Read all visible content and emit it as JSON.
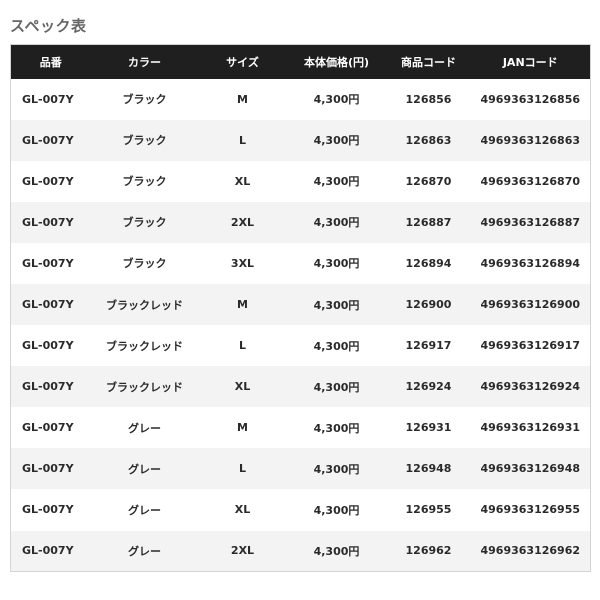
{
  "section_title": "スペック表",
  "table": {
    "headers": [
      "品番",
      "カラー",
      "サイズ",
      "本体価格(円)",
      "商品コード",
      "JANコード"
    ],
    "rows": [
      [
        "GL-007Y",
        "ブラック",
        "M",
        "4,300円",
        "126856",
        "4969363126856"
      ],
      [
        "GL-007Y",
        "ブラック",
        "L",
        "4,300円",
        "126863",
        "4969363126863"
      ],
      [
        "GL-007Y",
        "ブラック",
        "XL",
        "4,300円",
        "126870",
        "4969363126870"
      ],
      [
        "GL-007Y",
        "ブラック",
        "2XL",
        "4,300円",
        "126887",
        "4969363126887"
      ],
      [
        "GL-007Y",
        "ブラック",
        "3XL",
        "4,300円",
        "126894",
        "4969363126894"
      ],
      [
        "GL-007Y",
        "ブラックレッド",
        "M",
        "4,300円",
        "126900",
        "4969363126900"
      ],
      [
        "GL-007Y",
        "ブラックレッド",
        "L",
        "4,300円",
        "126917",
        "4969363126917"
      ],
      [
        "GL-007Y",
        "ブラックレッド",
        "XL",
        "4,300円",
        "126924",
        "4969363126924"
      ],
      [
        "GL-007Y",
        "グレー",
        "M",
        "4,300円",
        "126931",
        "4969363126931"
      ],
      [
        "GL-007Y",
        "グレー",
        "L",
        "4,300円",
        "126948",
        "4969363126948"
      ],
      [
        "GL-007Y",
        "グレー",
        "XL",
        "4,300円",
        "126955",
        "4969363126955"
      ],
      [
        "GL-007Y",
        "グレー",
        "2XL",
        "4,300円",
        "126962",
        "4969363126962"
      ]
    ]
  },
  "colors": {
    "header_bg": "#1f1f1f",
    "header_text": "#ffffff",
    "stripe_bg": "#f3f3f3",
    "title_text": "#666666"
  }
}
